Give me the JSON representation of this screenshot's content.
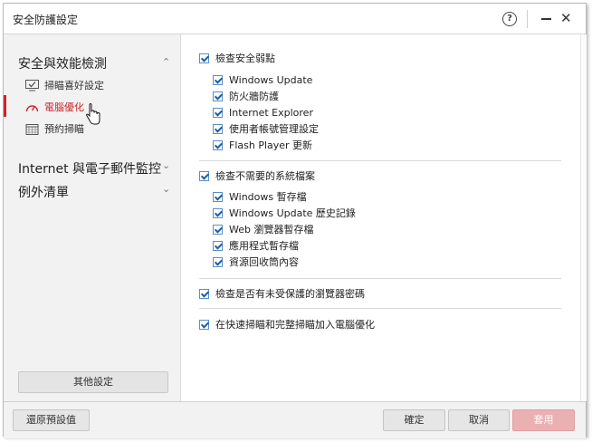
{
  "window": {
    "title": "安全防護設定",
    "help_icon": "help-circle-icon",
    "minimize_icon": "minimize-icon",
    "close_icon": "close-icon",
    "help_glyph": "?",
    "close_glyph": "✕"
  },
  "sidebar": {
    "sections": [
      {
        "label": "安全與效能檢測",
        "expanded": true,
        "chevron": "⌃"
      },
      {
        "label": "Internet 與電子郵件監控",
        "expanded": false,
        "chevron": "⌄"
      },
      {
        "label": "例外清單",
        "expanded": false,
        "chevron": "⌄"
      }
    ],
    "sub_items": [
      {
        "label": "掃瞄喜好設定",
        "icon": "monitor-check-icon",
        "active": false
      },
      {
        "label": "電腦優化",
        "icon": "speedometer-icon",
        "active": true
      },
      {
        "label": "預約掃瞄",
        "icon": "calendar-icon",
        "active": false
      }
    ],
    "other_settings_label": "其他設定",
    "accent_color": "#c9282d"
  },
  "content": {
    "groups": [
      {
        "label": "檢查安全弱點",
        "checked": true,
        "items": [
          {
            "label": "Windows Update",
            "checked": true
          },
          {
            "label": "防火牆防護",
            "checked": true
          },
          {
            "label": "Internet Explorer",
            "checked": true
          },
          {
            "label": "使用者帳號管理設定",
            "checked": true
          },
          {
            "label": "Flash Player 更新",
            "checked": true
          }
        ]
      },
      {
        "label": "檢查不需要的系統檔案",
        "checked": true,
        "items": [
          {
            "label": "Windows 暫存檔",
            "checked": true
          },
          {
            "label": "Windows Update 歷史記錄",
            "checked": true
          },
          {
            "label": "Web 瀏覽器暫存檔",
            "checked": true
          },
          {
            "label": "應用程式暫存檔",
            "checked": true
          },
          {
            "label": "資源回收筒內容",
            "checked": true
          }
        ]
      },
      {
        "label": "檢查是否有未受保護的瀏覽器密碼",
        "checked": true,
        "items": []
      },
      {
        "label": "在快速掃瞄和完整掃瞄加入電腦優化",
        "checked": true,
        "items": []
      }
    ]
  },
  "footer": {
    "restore_defaults": "還原預設值",
    "ok": "確定",
    "cancel": "取消",
    "apply": "套用",
    "apply_color": "#eab0b2"
  }
}
